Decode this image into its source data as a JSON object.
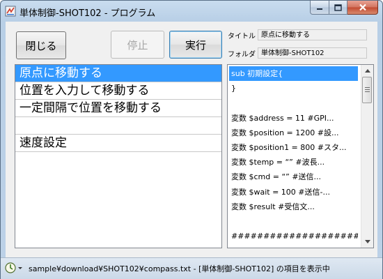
{
  "window": {
    "title": "単体制御-SHOT102 - プログラム",
    "icon": "app-icon"
  },
  "toolbar": {
    "close_label": "閉じる",
    "stop_label": "停止",
    "run_label": "実行"
  },
  "info": {
    "title_label": "タイトル",
    "title_value": "原点に移動する",
    "folder_label": "フォルダ",
    "folder_value": "単体制御-SHOT102"
  },
  "items": [
    {
      "label": "原点に移動する",
      "selected": true
    },
    {
      "label": "位置を入力して移動する",
      "selected": false
    },
    {
      "label": "一定間隔で位置を移動する",
      "selected": false
    },
    {
      "label": "",
      "selected": false
    },
    {
      "label": "速度設定",
      "selected": false
    }
  ],
  "code": [
    "sub 初期設定{",
    "}",
    "",
    "変数 $address = 11      #GPI...",
    "変数 $position = 1200  #設...",
    "変数 $position1 = 800 #スタ...",
    "変数 $temp = “”          #波長...",
    "変数 $cmd = “”          #送信...",
    "変数 $wait = 100       #送信-...",
    "変数 $result           #受信文...",
    "",
    "##################### プロ..."
  ],
  "status": {
    "text": "sample¥download¥SHOT102¥compass.txt - [単体制御-SHOT102] の項目を表示中"
  },
  "colors": {
    "selection": "#3399ff",
    "title_bar": "#c9dcef",
    "close_button": "#c24a31"
  }
}
